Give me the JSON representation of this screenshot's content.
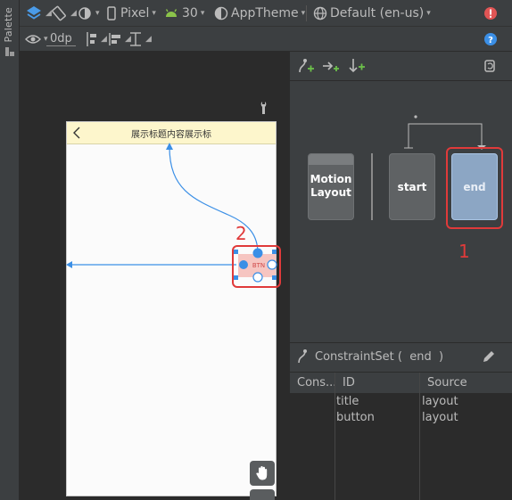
{
  "palette": {
    "label": "Palette"
  },
  "toolbar": {
    "device": "Pixel",
    "api": "30",
    "theme": "AppTheme",
    "locale": "Default (en-us)",
    "margin": "0dp"
  },
  "phone": {
    "title_text": "展示标题内容展示标",
    "button_text": "BTN"
  },
  "motion": {
    "layout_label_line1": "Motion",
    "layout_label_line2": "Layout",
    "start_label": "start",
    "end_label": "end"
  },
  "annotations": {
    "num1": "1",
    "num2": "2"
  },
  "constraint_set": {
    "title": "ConstraintSet (  end  )",
    "columns": [
      "Cons...",
      "ID",
      "Source"
    ],
    "rows": [
      {
        "id": "title",
        "source": "layout"
      },
      {
        "id": "button",
        "source": "layout"
      }
    ]
  },
  "colors": {
    "accent": "#3b8fe6",
    "annotation": "#e03a3a",
    "end_state": "#8ca6c4",
    "error": "#e05555"
  }
}
